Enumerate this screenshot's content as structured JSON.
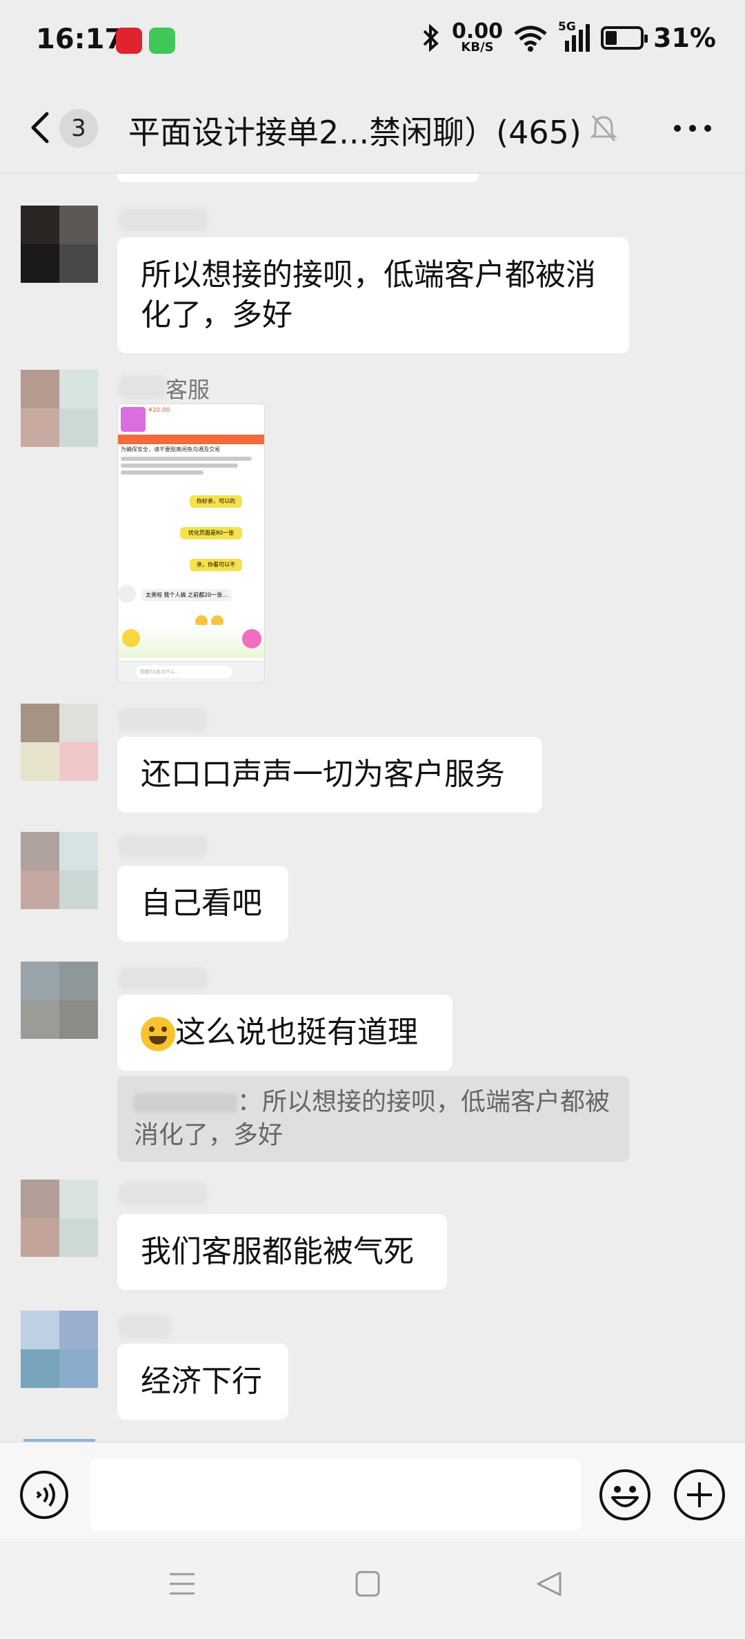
{
  "status_bar": {
    "time": "16:17",
    "net_speed_value": "0.00",
    "net_speed_unit": "KB/S",
    "signal_type": "5G",
    "battery": "31%"
  },
  "header": {
    "unread_count": "3",
    "title": "平面设计接单2...禁闲聊）(465)"
  },
  "messages": [
    {
      "text": "所以想接的接呗，低端客户都被消化了，多好"
    },
    {
      "sender_suffix": "客服",
      "image": "screenshot"
    },
    {
      "text": "还口口声声一切为客户服务"
    },
    {
      "text": "自己看吧"
    },
    {
      "text": "这么说也挺有道理",
      "quote": "：所以想接的接呗，低端客户都被消化了，多好"
    },
    {
      "text": "我们客服都能被气死"
    },
    {
      "text": "经济下行"
    }
  ],
  "thumbnail_chat": {
    "price": "¥10.00",
    "warning": "为确保安全，请不要脱离闲鱼沟通及交易",
    "b1": "你好亲，可以的",
    "b2": "优化页面是80一张",
    "b3": "亲，你看可以不",
    "r1": "太贵啦 我个人搞 之前都20一张...",
    "input_placeholder": "想跟TA说点什么..."
  },
  "colors": {
    "background": "#ededed",
    "bubble": "#ffffff",
    "quote_bg": "#dfdfdf",
    "warning_bar": "#f26b3a",
    "chat_bubble_yellow": "#f7e14c"
  }
}
